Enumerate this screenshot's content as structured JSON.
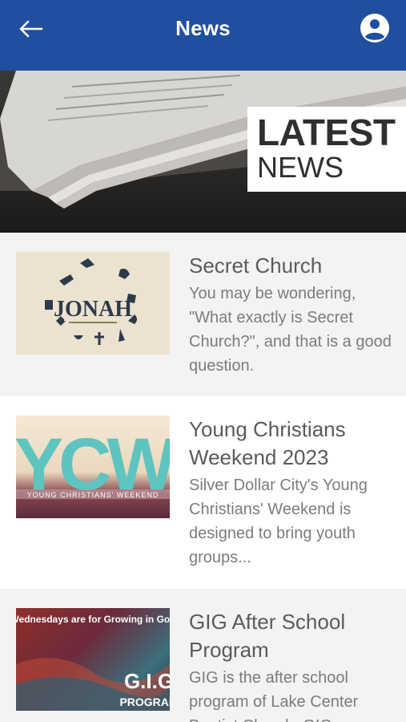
{
  "header": {
    "title": "News",
    "back_icon": "arrow-left-icon",
    "profile_icon": "account-circle-icon",
    "bar_color": "#1f4f9e"
  },
  "hero": {
    "line1": "LATEST",
    "line2": "NEWS"
  },
  "news": [
    {
      "title": "Secret Church",
      "description": "You may be wondering, \"What exactly is Secret Church?\", and that is a good question.",
      "thumb_text": "JONAH"
    },
    {
      "title": "Young Christians Weekend 2023",
      "description": "Silver Dollar City's Young Christians' Weekend is designed to bring youth groups...",
      "thumb_text": "YCW",
      "thumb_subtext": "YOUNG CHRISTIANS' WEEKEND"
    },
    {
      "title": "GIG After School Program",
      "description": "GIG is the after school program of Lake Center Baptist Church. GIG...",
      "thumb_text": "Wednesdays are for Growing in God",
      "thumb_badge": "G.I.G",
      "thumb_badge2": "PROGRAM"
    }
  ]
}
